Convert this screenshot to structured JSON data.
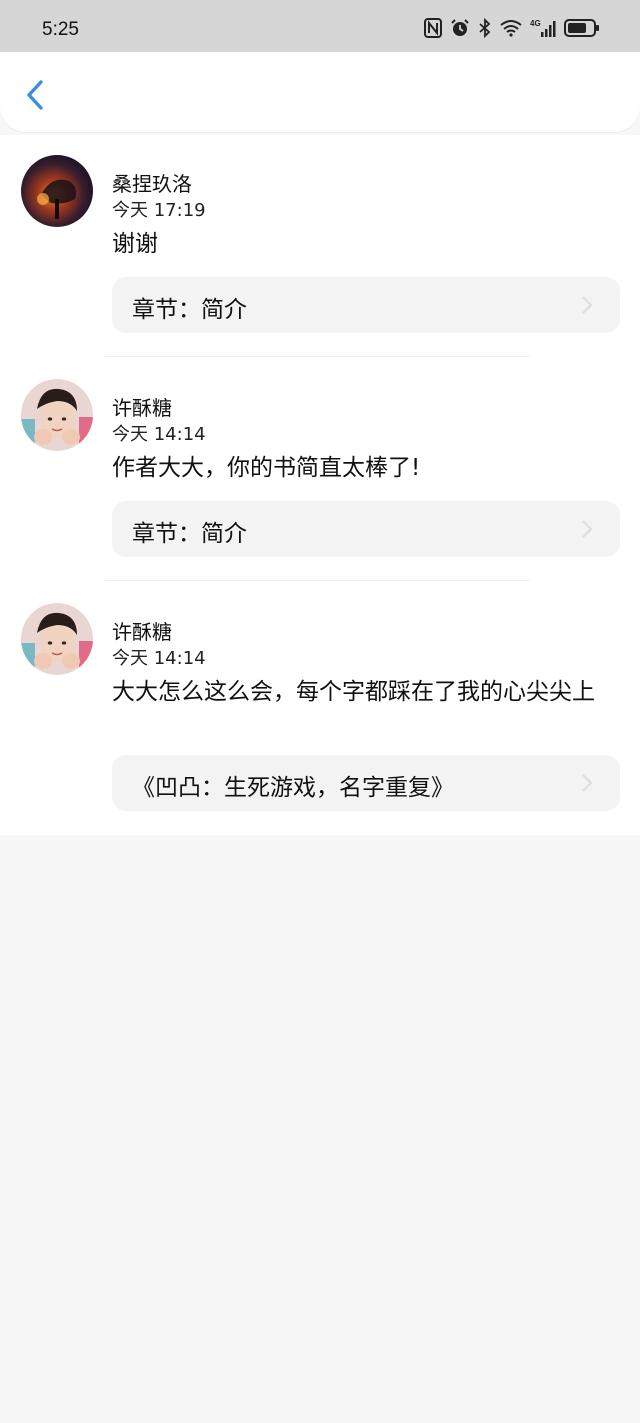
{
  "status_bar": {
    "time": "5:25",
    "icons": [
      "nfc-icon",
      "alarm-icon",
      "bluetooth-icon",
      "wifi-icon",
      "signal-4g-icon",
      "battery-icon"
    ]
  },
  "nav": {
    "back_icon": "chevron-left-icon",
    "accent_color": "#3a8fd9"
  },
  "comments": [
    {
      "user": "桑捏玖洛",
      "time": "今天 17:19",
      "message": "谢谢",
      "chapter": "章节：简介"
    },
    {
      "user": "许酥糖",
      "time": "今天 14:14",
      "message": "作者大大，你的书简直太棒了!",
      "chapter": "章节：简介"
    },
    {
      "user": "许酥糖",
      "time": "今天 14:14",
      "message": "大大怎么这么会，每个字都踩在了我的心尖尖上",
      "chapter": "《凹凸：生死游戏，名字重复》"
    }
  ]
}
